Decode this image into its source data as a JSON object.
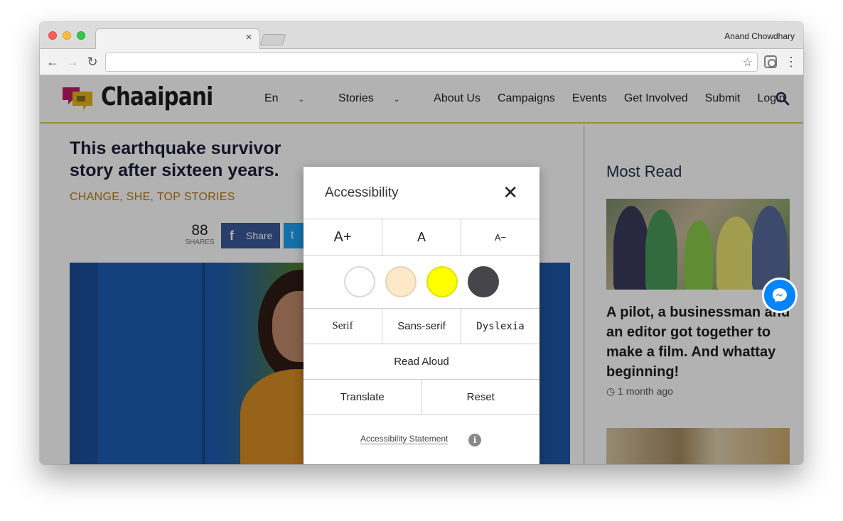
{
  "browser": {
    "profile_name": "Anand Chowdhary",
    "tab_close": "×",
    "back": "←",
    "forward": "→",
    "reload": "↻",
    "star": "☆",
    "menu": "⋮",
    "address": ""
  },
  "site": {
    "logo_text": "Chaaipani",
    "nav": [
      {
        "label": "En",
        "caret": "⌄"
      },
      {
        "label": "Stories",
        "caret": "⌄"
      },
      {
        "label": "About Us"
      },
      {
        "label": "Campaigns"
      },
      {
        "label": "Events"
      },
      {
        "label": "Get Involved"
      },
      {
        "label": "Submit"
      },
      {
        "label": "Login"
      }
    ]
  },
  "article": {
    "title_line1": "This earthquake survivor",
    "title_line2": "story after sixteen years.",
    "categories": "CHANGE,  SHE,  TOP STORIES",
    "share_count": "88",
    "share_label": "SHARES",
    "fb_label": "Share",
    "fb_icon": "f",
    "tw_icon": "t"
  },
  "sidebar": {
    "heading": "Most Read",
    "item_title": "A pilot, a businessman and an editor got together to make a film. And whattay beginning!",
    "item_time": "1 month ago"
  },
  "a11y": {
    "title": "Accessibility",
    "close": "✕",
    "sizes": [
      "A+",
      "A",
      "A−"
    ],
    "swatches": [
      {
        "name": "white",
        "color": "#ffffff",
        "border": "#d8d8d8"
      },
      {
        "name": "cream",
        "color": "#fde8c8",
        "border": "#e5d3b4"
      },
      {
        "name": "yellow",
        "color": "#ffff00",
        "border": "#e1e100"
      },
      {
        "name": "dark",
        "color": "#46464a",
        "border": "#46464a"
      }
    ],
    "fonts": [
      "Serif",
      "Sans-serif",
      "Dyslexia"
    ],
    "read_aloud": "Read Aloud",
    "translate": "Translate",
    "reset": "Reset",
    "statement": "Accessibility Statement",
    "info": "i"
  },
  "colors": {
    "accent_gold": "#e3c55a",
    "category": "#b37a16",
    "facebook": "#3b5998",
    "twitter": "#1da1f2",
    "messenger": "#0084ff"
  }
}
